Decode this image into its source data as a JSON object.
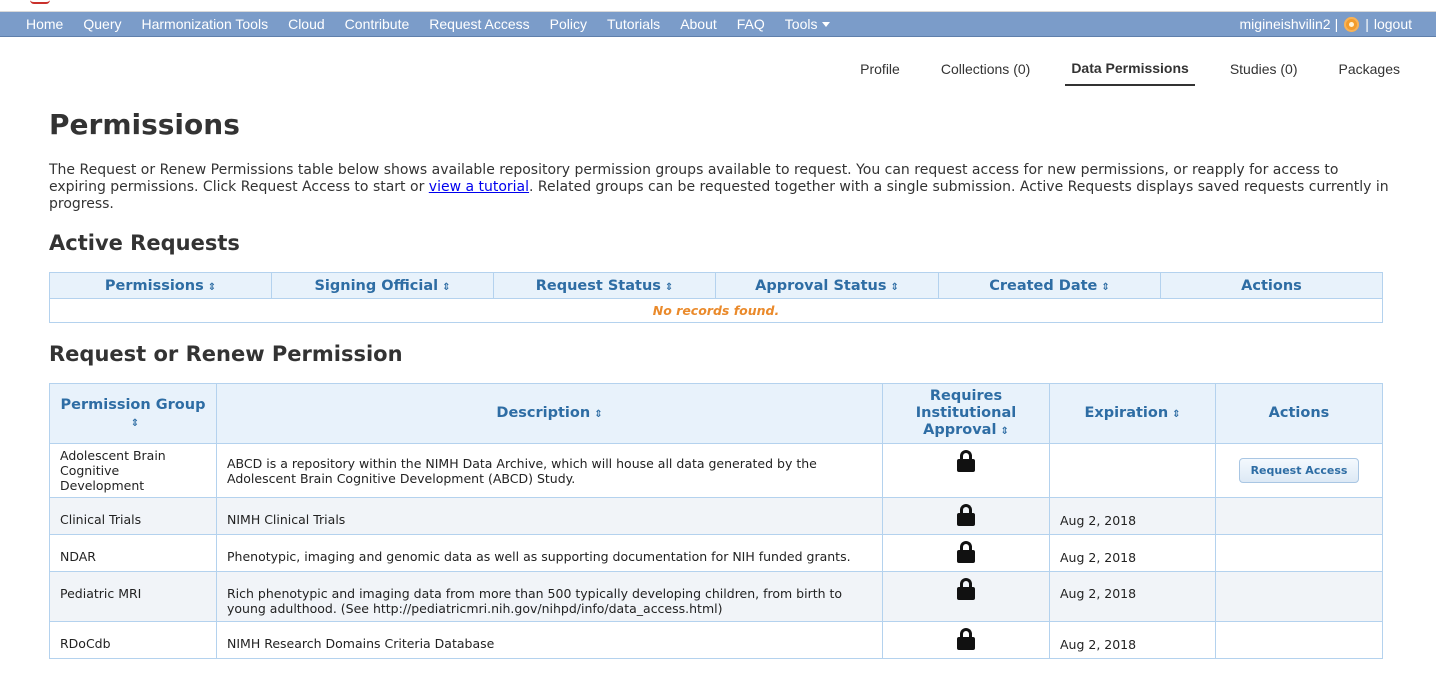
{
  "nav": {
    "items": [
      "Home",
      "Query",
      "Harmonization Tools",
      "Cloud",
      "Contribute",
      "Request Access",
      "Policy",
      "Tutorials",
      "About",
      "FAQ",
      "Tools"
    ],
    "username": "migineishvilin2",
    "separator": "|",
    "logout": "logout"
  },
  "subtabs": [
    {
      "label": "Profile"
    },
    {
      "label": "Collections (0)"
    },
    {
      "label": "Data Permissions"
    },
    {
      "label": "Studies (0)"
    },
    {
      "label": "Packages"
    }
  ],
  "page": {
    "title": "Permissions",
    "intro_before_link": "The Request or Renew Permissions table below shows available repository permission groups available to request. You can request access for new permissions, or reapply for access to expiring permissions. Click Request Access to start or ",
    "intro_link": "view a tutorial",
    "intro_after_link": ". Related groups can be requested together with a single submission. Active Requests displays saved requests currently in progress."
  },
  "active_requests": {
    "heading": "Active Requests",
    "columns": [
      "Permissions",
      "Signing Official",
      "Request Status",
      "Approval Status",
      "Created Date",
      "Actions"
    ],
    "empty_message": "No records found."
  },
  "request_renew": {
    "heading": "Request or Renew Permission",
    "columns": {
      "group": "Permission Group",
      "description": "Description",
      "requires": "Requires Institutional Approval",
      "expiration": "Expiration",
      "actions": "Actions"
    },
    "rows": [
      {
        "group": "Adolescent Brain Cognitive Development",
        "description": "ABCD is a repository within the NIMH Data Archive, which will house all data generated by the Adolescent Brain Cognitive Development (ABCD) Study.",
        "requires_icon": "lock-icon",
        "expiration": "",
        "action": "Request Access"
      },
      {
        "group": "Clinical Trials",
        "description": "NIMH Clinical Trials",
        "requires_icon": "lock-icon",
        "expiration": "Aug 2, 2018",
        "action": ""
      },
      {
        "group": "NDAR",
        "description": "Phenotypic, imaging and genomic data as well as supporting documentation for NIH funded grants.",
        "requires_icon": "lock-icon",
        "expiration": "Aug 2, 2018",
        "action": ""
      },
      {
        "group": "Pediatric MRI",
        "description": "Rich phenotypic and imaging data from more than 500 typically developing children, from birth to young adulthood. (See http://pediatricmri.nih.gov/nihpd/info/data_access.html)",
        "requires_icon": "lock-icon",
        "expiration": "Aug 2, 2018",
        "action": ""
      },
      {
        "group": "RDoCdb",
        "description": "NIMH Research Domains Criteria Database",
        "requires_icon": "lock-icon",
        "expiration": "Aug 2, 2018",
        "action": ""
      }
    ]
  },
  "colors": {
    "navbar": "#7b9cc9",
    "header_text": "#2e6da4",
    "empty_text": "#ea8a2b"
  }
}
